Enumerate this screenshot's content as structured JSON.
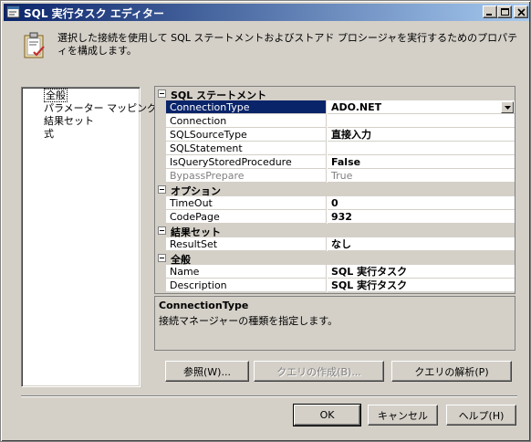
{
  "window": {
    "title": "SQL 実行タスク エディター"
  },
  "header": {
    "description": "選択した接続を使用して SQL ステートメントおよびストアド プロシージャを実行するためのプロパティを構成します。"
  },
  "nav": {
    "items": [
      {
        "label": "全般",
        "selected": true
      },
      {
        "label": "パラメーター マッピング",
        "selected": false
      },
      {
        "label": "結果セット",
        "selected": false
      },
      {
        "label": "式",
        "selected": false
      }
    ]
  },
  "grid": {
    "categories": [
      {
        "label": "SQL ステートメント",
        "props": [
          {
            "name": "ConnectionType",
            "value": "ADO.NET",
            "selected": true,
            "has_dropdown": true
          },
          {
            "name": "Connection",
            "value": ""
          },
          {
            "name": "SQLSourceType",
            "value": "直接入力"
          },
          {
            "name": "SQLStatement",
            "value": ""
          },
          {
            "name": "IsQueryStoredProcedure",
            "value": "False"
          },
          {
            "name": "BypassPrepare",
            "value": "True",
            "disabled": true
          }
        ]
      },
      {
        "label": "オプション",
        "props": [
          {
            "name": "TimeOut",
            "value": "0"
          },
          {
            "name": "CodePage",
            "value": "932"
          }
        ]
      },
      {
        "label": "結果セット",
        "props": [
          {
            "name": "ResultSet",
            "value": "なし"
          }
        ]
      },
      {
        "label": "全般",
        "props": [
          {
            "name": "Name",
            "value": "SQL 実行タスク"
          },
          {
            "name": "Description",
            "value": "SQL 実行タスク"
          }
        ]
      }
    ]
  },
  "description_panel": {
    "title": "ConnectionType",
    "text": "接続マネージャーの種類を指定します。"
  },
  "action_buttons": {
    "browse": "参照(W)...",
    "build_query": "クエリの作成(B)...",
    "parse_query": "クエリの解析(P)"
  },
  "footer_buttons": {
    "ok": "OK",
    "cancel": "キャンセル",
    "help": "ヘルプ(H)"
  },
  "colors": {
    "titlebar_start": "#0a246a",
    "titlebar_end": "#a6caf0",
    "selection": "#0a246a",
    "face": "#d4d0c8"
  }
}
